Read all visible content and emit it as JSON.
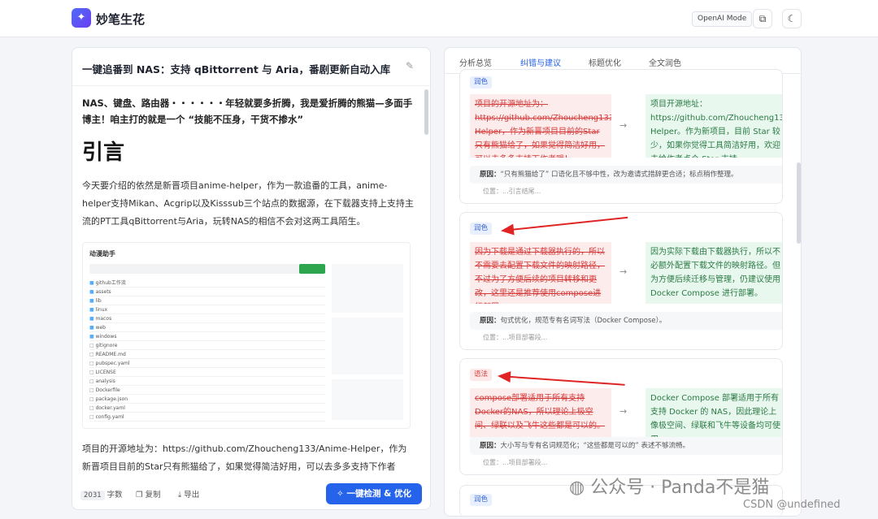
{
  "app": {
    "name": "妙笔生花",
    "mode": "OpenAI Mode"
  },
  "editor": {
    "title": "一键追番到 NAS：支持 qBittorrent 与 Aria，番剧更新自动入库",
    "subtitle": "NAS、键盘、路由器・・・・・・年轻就要多折腾，我是爱折腾的熊猫—多面手博主！咱主打的就是一个 “技能不压身，干货不掺水”",
    "heading": "引言",
    "para1": "今天要介绍的依然是新晋项目anime-helper，作为一款追番的工具，anime-helper支持Mikan、Acgrip以及Kisssub三个站点的数据源，在下载器支持上支持主流的PT工具qBittorrent与Aria，玩转NAS的相信不会对这两工具陌生。",
    "para2": "项目的开源地址为：https://github.com/Zhoucheng133/Anime-Helper，作为新晋项目目前的Star只有熊猫给了，如果觉得简洁好用，可以去多多支持下作者",
    "word_count": "2031",
    "word_unit": "字数",
    "copy_label": "复制",
    "export_label": "导出",
    "cta_label": "一键检测 & 优化"
  },
  "tabs": [
    "分析总览",
    "纠错与建议",
    "标题优化",
    "全文润色"
  ],
  "active_tab": "纠错与建议",
  "suggestions": [
    {
      "tag": "润色",
      "old": "项目的开源地址为：https://github.com/Zhoucheng133/Anime-Helper，作为新晋项目目前的Star只有熊猫给了，如果觉得简洁好用，可以去多多支持下作者哦！",
      "new": "项目开源地址：https://github.com/Zhoucheng133/Anime-Helper。作为新项目，目前 Star 较少，如果你觉得工具简洁好用，欢迎去给作者点个 Star 支持。",
      "reason_label": "原因：",
      "reason": "“只有熊猫给了” 口语化且不够中性，改为邀请式措辞更合适；标点稍作整理。",
      "loc": "位置：...引言结尾..."
    },
    {
      "tag": "润色",
      "old": "因为下载是通过下载器执行的，所以不需要去配置下载文件的映射路径，不过为了方便后续的项目转移和更改，这里还是推荐使用compose进行部署。",
      "new": "因为实际下载由下载器执行，所以不必额外配置下载文件的映射路径。但为方便后续迁移与管理，仍建议使用 Docker Compose 进行部署。",
      "reason_label": "原因：",
      "reason": "句式优化，规范专有名词写法（Docker Compose）。",
      "loc": "位置：...项目部署段..."
    },
    {
      "tag": "语法",
      "old": "compose部署适用于所有支持Docker的NAS，所以理论上极空间、绿联以及飞牛这些都是可以的。",
      "new": "Docker Compose 部署适用于所有支持 Docker 的 NAS，因此理论上像极空间、绿联和飞牛等设备均可使用。",
      "reason_label": "原因：",
      "reason": "大小写与专有名词规范化；“这些都是可以的” 表述不够流畅。",
      "loc": "位置：...项目部署段..."
    },
    {
      "tag": "润色"
    }
  ],
  "screenshot": {
    "app_title": "动漫助手",
    "rows": [
      "github工作流",
      "assets",
      "lib",
      "linux",
      "macos",
      "web",
      "windows",
      "gitignore",
      "README.md",
      "pubspec.yaml",
      "LICENSE",
      "analysis",
      "Dockerfile",
      "package.json",
      "docker.yaml",
      "config.yaml"
    ]
  },
  "watermark": {
    "wechat": "公众号 · Panda不是猫",
    "csdn": "CSDN @undefined"
  },
  "colors": {
    "accent": "#2563eb",
    "delete": "#d63a3a",
    "insert": "#2a7a45",
    "arrow": "#e02424"
  }
}
